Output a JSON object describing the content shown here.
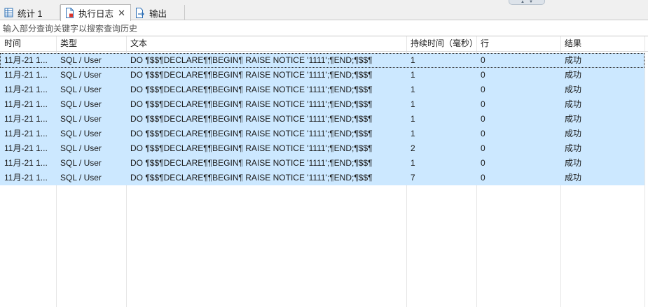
{
  "tabs": [
    {
      "label": "统计 1",
      "icon": "table-icon"
    },
    {
      "label": "执行日志",
      "icon": "log-document-icon",
      "active": true
    },
    {
      "label": "输出",
      "icon": "export-document-icon"
    }
  ],
  "search": {
    "placeholder": "输入部分查询关键字以搜索查询历史",
    "value": ""
  },
  "columns": [
    "时间",
    "类型",
    "文本",
    "持续时间（毫秒）",
    "行",
    "结果"
  ],
  "rows": [
    {
      "time": "11月-21 1...",
      "type": "SQL / User",
      "text": "DO ¶$$¶DECLARE¶¶BEGIN¶ RAISE NOTICE '1111';¶END;¶$$¶",
      "duration": "1",
      "rows": "0",
      "result": "成功"
    },
    {
      "time": "11月-21 1...",
      "type": "SQL / User",
      "text": "DO ¶$$¶DECLARE¶¶BEGIN¶ RAISE NOTICE '1111';¶END;¶$$¶",
      "duration": "1",
      "rows": "0",
      "result": "成功"
    },
    {
      "time": "11月-21 1...",
      "type": "SQL / User",
      "text": "DO ¶$$¶DECLARE¶¶BEGIN¶ RAISE NOTICE '1111';¶END;¶$$¶",
      "duration": "1",
      "rows": "0",
      "result": "成功"
    },
    {
      "time": "11月-21 1...",
      "type": "SQL / User",
      "text": "DO ¶$$¶DECLARE¶¶BEGIN¶ RAISE NOTICE '1111';¶END;¶$$¶",
      "duration": "1",
      "rows": "0",
      "result": "成功"
    },
    {
      "time": "11月-21 1...",
      "type": "SQL / User",
      "text": "DO ¶$$¶DECLARE¶¶BEGIN¶ RAISE NOTICE '1111';¶END;¶$$¶",
      "duration": "1",
      "rows": "0",
      "result": "成功"
    },
    {
      "time": "11月-21 1...",
      "type": "SQL / User",
      "text": "DO ¶$$¶DECLARE¶¶BEGIN¶ RAISE NOTICE '1111';¶END;¶$$¶",
      "duration": "1",
      "rows": "0",
      "result": "成功"
    },
    {
      "time": "11月-21 1...",
      "type": "SQL / User",
      "text": "DO ¶$$¶DECLARE¶¶BEGIN¶ RAISE NOTICE '1111';¶END;¶$$¶",
      "duration": "2",
      "rows": "0",
      "result": "成功"
    },
    {
      "time": "11月-21 1...",
      "type": "SQL / User",
      "text": "DO ¶$$¶DECLARE¶¶BEGIN¶ RAISE NOTICE '1111';¶END;¶$$¶",
      "duration": "1",
      "rows": "0",
      "result": "成功"
    },
    {
      "time": "11月-21 1...",
      "type": "SQL / User",
      "text": "DO ¶$$¶DECLARE¶¶BEGIN¶ RAISE NOTICE '1111';¶END;¶$$¶",
      "duration": "7",
      "rows": "0",
      "result": "成功"
    }
  ],
  "colors": {
    "selection": "#cce8ff",
    "tab_strip": "#f0f0f0",
    "icon_blue": "#2d6fb5",
    "icon_red": "#d9322b"
  }
}
